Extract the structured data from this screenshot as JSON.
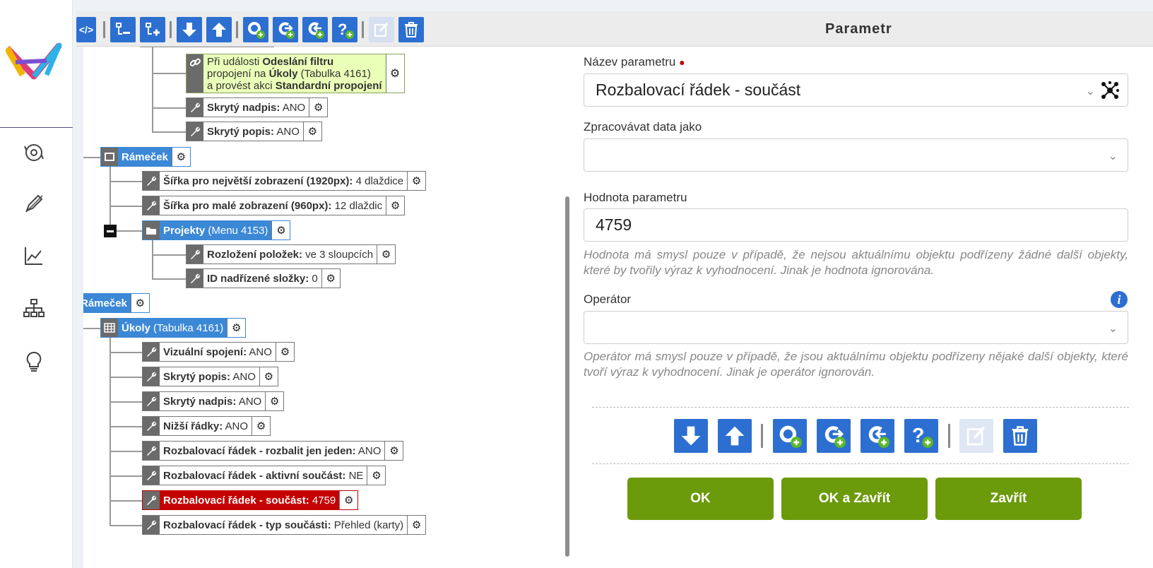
{
  "panel": {
    "title": "Parametr"
  },
  "tree": {
    "nodes": [
      {
        "bold_a": "Při události ",
        "bold_b": "Odeslání filtru",
        "l2a": "propojení na ",
        "l2b": "Úkoly",
        "l2c": " (Tabulka 4161)",
        "l3a": "a provést akci ",
        "l3b": "Standardní propojení"
      },
      {
        "label": "Skrytý nadpis:",
        "value": " ANO"
      },
      {
        "label": "Skrytý popis:",
        "value": " ANO"
      },
      {
        "label": "Rámeček",
        "value": ""
      },
      {
        "label": "Šířka pro největší zobrazení (1920px):",
        "value": " 4 dlaždice"
      },
      {
        "label": "Šířka pro malé zobrazení (960px):",
        "value": " 12 dlaždic"
      },
      {
        "label": "Projekty",
        "value": " (Menu 4153)"
      },
      {
        "label": "Rozložení položek:",
        "value": " ve 3 sloupcích"
      },
      {
        "label": "ID nadřízené složky:",
        "value": " 0"
      },
      {
        "label": "Rámeček",
        "value": ""
      },
      {
        "label": "Úkoly",
        "value": " (Tabulka 4161)"
      },
      {
        "label": "Vizuální spojení:",
        "value": " ANO"
      },
      {
        "label": "Skrytý popis:",
        "value": " ANO"
      },
      {
        "label": "Skrytý nadpis:",
        "value": " ANO"
      },
      {
        "label": "Nižší řádky:",
        "value": " ANO"
      },
      {
        "label": "Rozbalovací řádek - rozbalit jen jeden:",
        "value": " ANO"
      },
      {
        "label": "Rozbalovací řádek - aktivní součást:",
        "value": " NE"
      },
      {
        "label": "Rozbalovací řádek - součást:",
        "value": " 4759"
      },
      {
        "label": "Rozbalovací řádek - typ součásti:",
        "value": " Přehled (karty)"
      }
    ]
  },
  "form": {
    "name_label": "Název parametru",
    "name_value": "Rozbalovací řádek - součást",
    "process_label": "Zpracovávat data jako",
    "process_value": "",
    "value_label": "Hodnota parametru",
    "value_value": "4759",
    "value_help": "Hodnota má smysl pouze v případě, že nejsou aktuálnímu objektu podřízeny žádné další objekty, které by tvořily výraz k vyhodnocení. Jinak je hodnota ignorována.",
    "operator_label": "Operátor",
    "operator_value": "",
    "operator_help": "Operátor má smysl pouze v případě, že jsou aktuálnímu objektu podřízeny nějaké další objekty, které tvoří výraz k vyhodnocení. Jinak je operátor ignorován."
  },
  "buttons": {
    "ok": "OK",
    "ok_close": "OK a Zavřít",
    "close": "Zavřít"
  },
  "colors": {
    "accent": "#2c6fd1",
    "node_blue": "#3b88d6",
    "selected": "#c40000",
    "green": "#6b9a0a",
    "required_dot": "#c40000"
  }
}
